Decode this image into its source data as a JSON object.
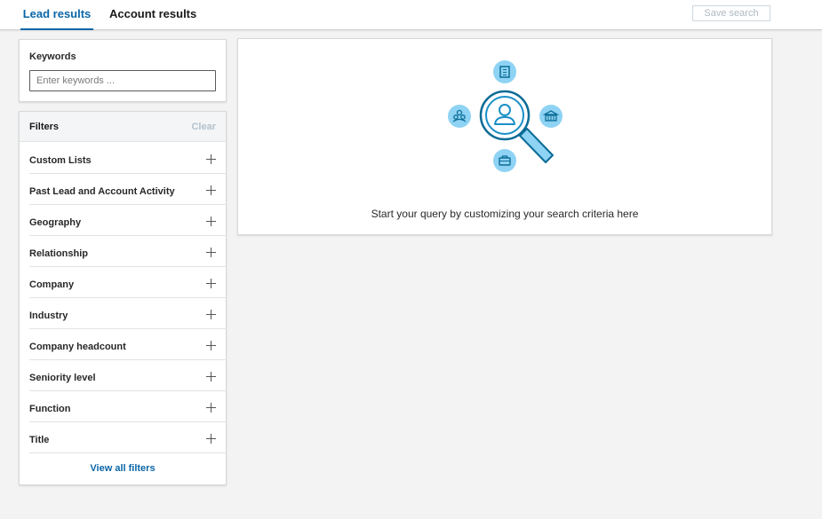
{
  "tabs": {
    "lead": "Lead results",
    "account": "Account results"
  },
  "toolbar": {
    "save_search": "Save search"
  },
  "keywords": {
    "label": "Keywords",
    "placeholder": "Enter keywords ..."
  },
  "filters": {
    "title": "Filters",
    "clear": "Clear",
    "items": [
      {
        "label": "Custom Lists"
      },
      {
        "label": "Past Lead and Account Activity"
      },
      {
        "label": "Geography"
      },
      {
        "label": "Relationship"
      },
      {
        "label": "Company"
      },
      {
        "label": "Industry"
      },
      {
        "label": "Company headcount"
      },
      {
        "label": "Seniority level"
      },
      {
        "label": "Function"
      },
      {
        "label": "Title"
      }
    ],
    "view_all": "View all filters"
  },
  "empty_state": {
    "message": "Start your query by customizing your search criteria here"
  },
  "colors": {
    "accent": "#0a66a8",
    "illustration_fill": "#8fd3f4",
    "illustration_stroke": "#0b6c96"
  }
}
